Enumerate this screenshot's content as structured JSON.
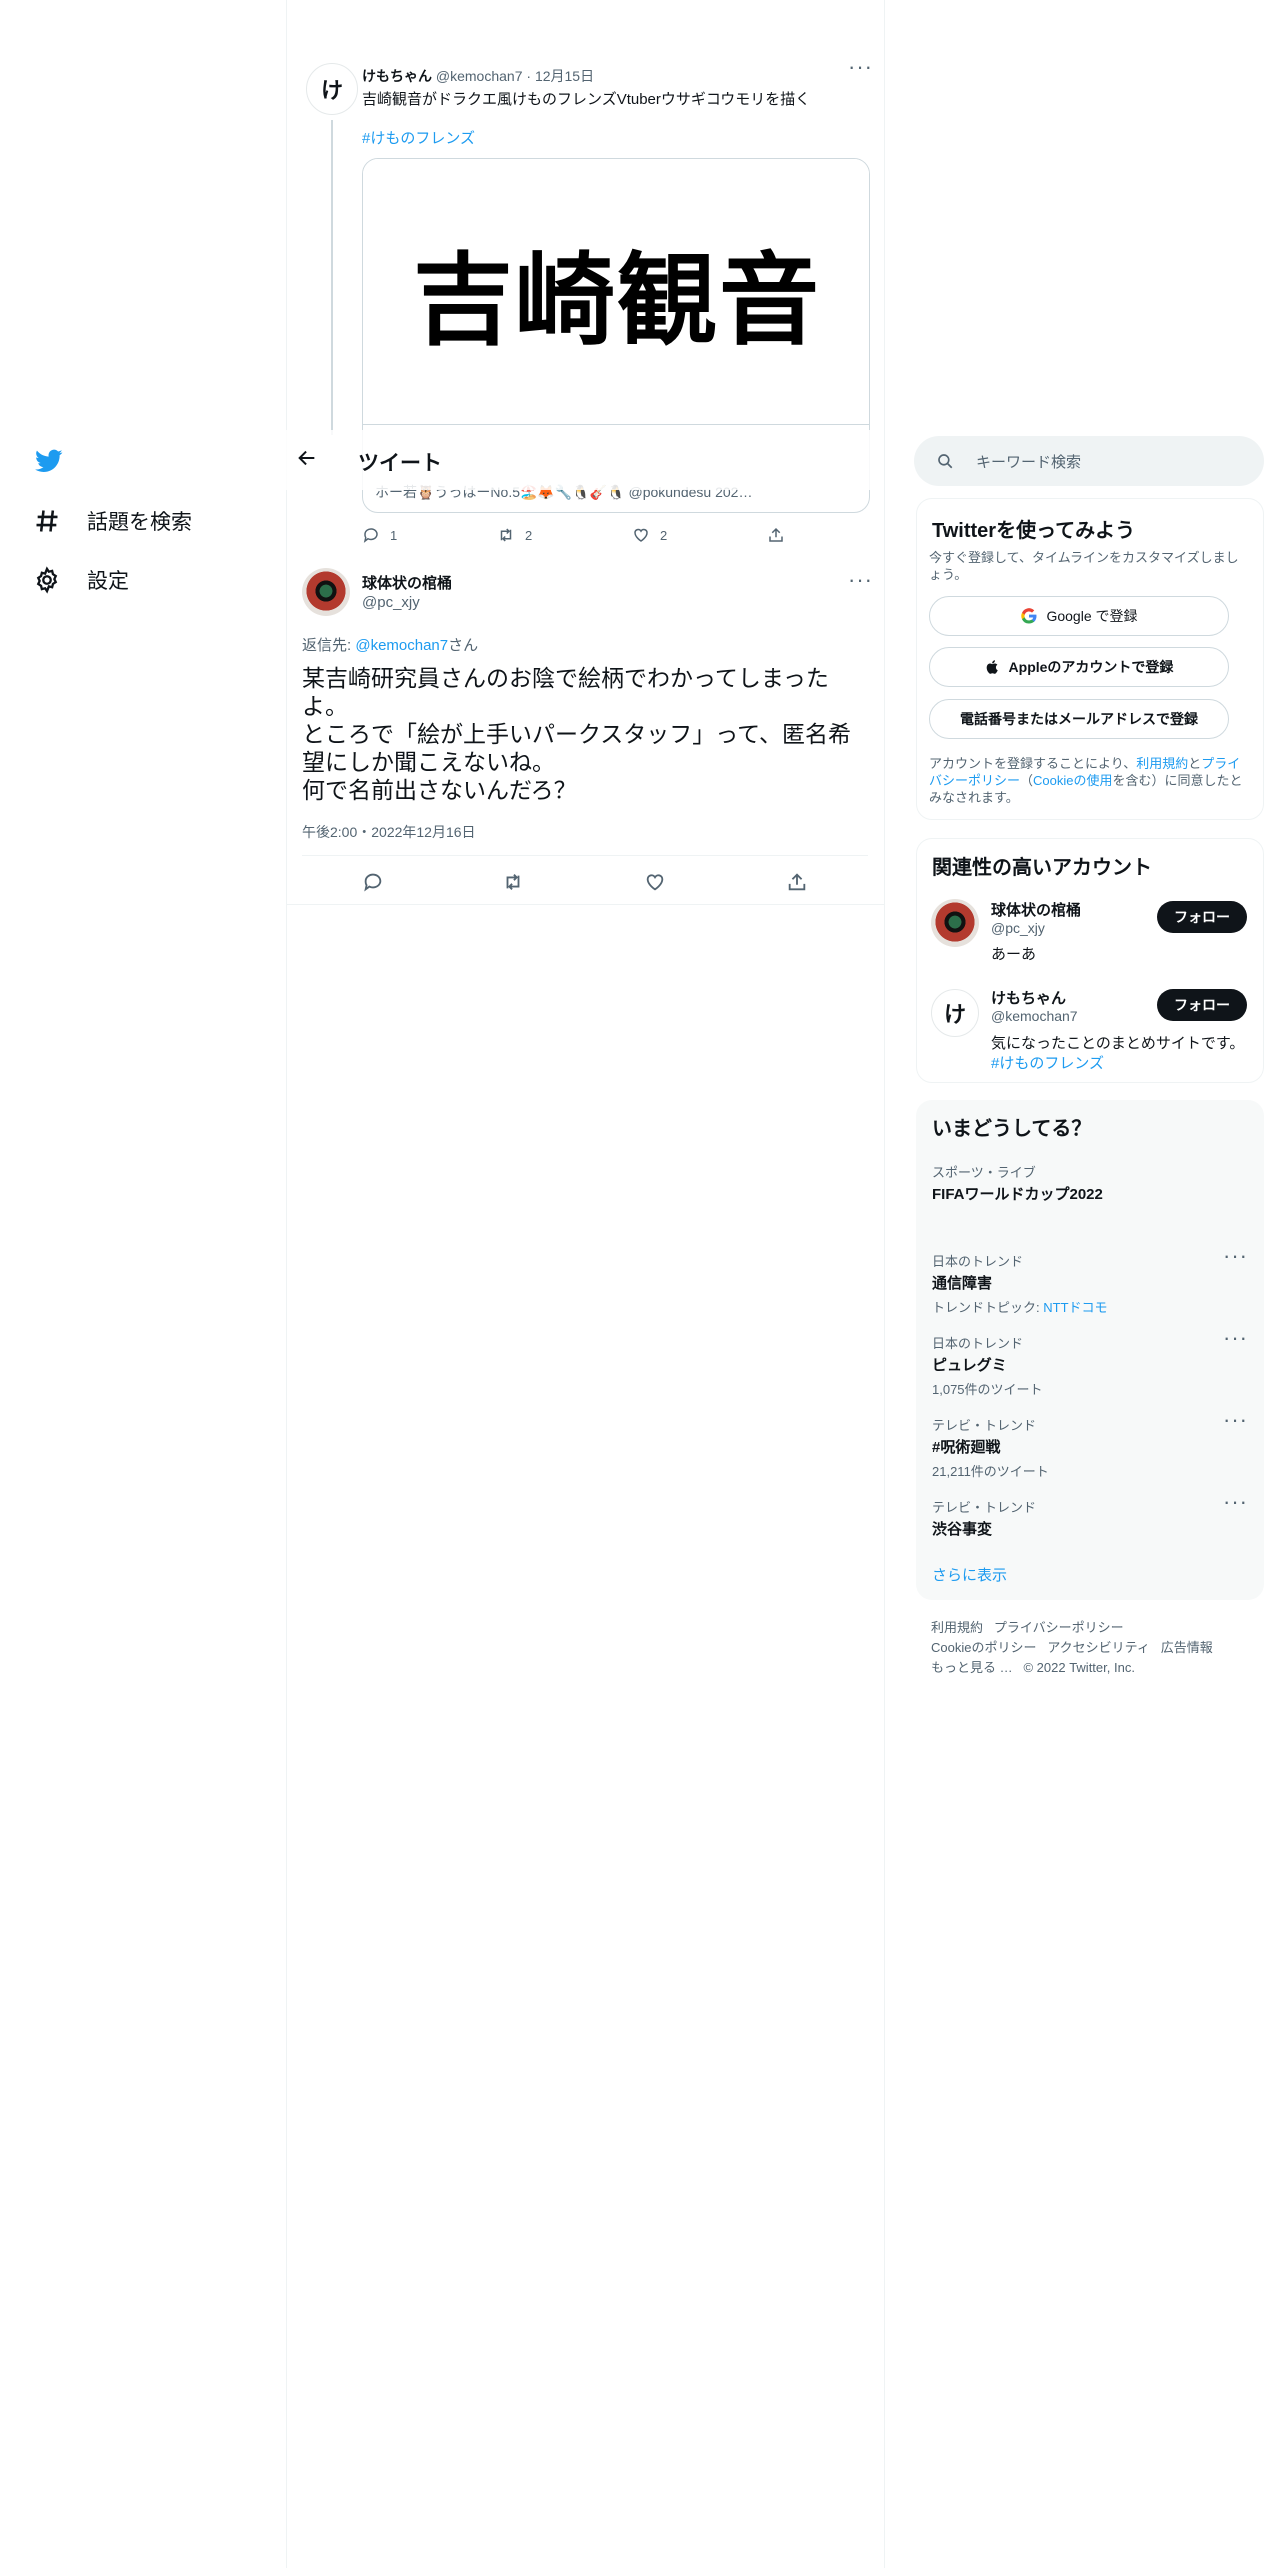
{
  "nav": {
    "logo": "twitter-bird-icon",
    "items": [
      {
        "label": "話題を検索",
        "icon": "hashtag-icon"
      },
      {
        "label": "設定",
        "icon": "gear-icon"
      }
    ]
  },
  "header": {
    "title": "ツイート"
  },
  "quoted_tweet": {
    "avatar_letter": "け",
    "name": "けもちゃん",
    "handle": "@kemochan7",
    "date": "12月15日",
    "text": "吉崎観音がドラクエ風けものフレンズVtuberウサギコウモリを描く",
    "hashtag": "#けものフレンズ",
    "card_image_text": "吉崎観音",
    "card_caption": "ホー若🦉うっはーNo.5🏖️🦊🔧🐧🎸🐧 @pokundesu 202…",
    "replies": "1",
    "retweets": "2",
    "likes": "2"
  },
  "main_tweet": {
    "name": "球体状の棺桶",
    "handle": "@pc_xjy",
    "reply_prefix": "返信先: ",
    "reply_to": "@kemochan7",
    "reply_suffix": "さん",
    "text_lines": [
      "某吉崎研究員さんのお陰で絵柄でわかってしまった",
      "よ。",
      "ところで「絵が上手いパークスタッフ」って、匿名希",
      "望にしか聞こえないね。",
      "何で名前出さないんだろ？"
    ],
    "timestamp": "午後2:00・2022年12月16日"
  },
  "search": {
    "placeholder": "キーワード検索"
  },
  "signup": {
    "title": "Twitterを使ってみよう",
    "desc": "今すぐ登録して、タイムラインをカスタマイズしましょう。",
    "google": "Google で登録",
    "apple": "Appleのアカウントで登録",
    "phone": "電話番号またはメールアドレスで登録",
    "terms_1": "アカウントを登録することにより、",
    "terms_link1": "利用規約",
    "terms_2": "と",
    "terms_link2": "プライバシーポリシー",
    "terms_3": "（",
    "terms_link3": "Cookieの使用",
    "terms_4": "を含む）に同意したとみなされます。"
  },
  "related": {
    "title": "関連性の高いアカウント",
    "follow_label": "フォロー",
    "accounts": [
      {
        "name": "球体状の棺桶",
        "handle": "@pc_xjy",
        "bio": "あーあ",
        "bio_link": ""
      },
      {
        "name": "けもちゃん",
        "handle": "@kemochan7",
        "bio": "気になったことのまとめサイトです。",
        "bio_link": "#けものフレンズ",
        "avatar_letter": "け"
      }
    ]
  },
  "trends": {
    "title": "いまどうしてる？",
    "items": [
      {
        "category": "スポーツ・ライブ",
        "name": "FIFAワールドカップ2022",
        "sub": "",
        "sub_link": ""
      },
      {
        "category": "日本のトレンド",
        "name": "通信障害",
        "sub": "トレンドトピック: ",
        "sub_link": "NTTドコモ"
      },
      {
        "category": "日本のトレンド",
        "name": "ピュレグミ",
        "sub": "1,075件のツイート",
        "sub_link": ""
      },
      {
        "category": "テレビ・トレンド",
        "name": "#呪術廻戦",
        "sub": "21,211件のツイート",
        "sub_link": ""
      },
      {
        "category": "テレビ・トレンド",
        "name": "渋谷事変",
        "sub": "",
        "sub_link": ""
      }
    ],
    "show_more": "さらに表示"
  },
  "footer": {
    "links_row1": [
      "利用規約",
      "プライバシーポリシー"
    ],
    "links_row2": [
      "Cookieのポリシー",
      "アクセシビリティ",
      "広告情報"
    ],
    "more": "もっと見る …",
    "copyright": "© 2022 Twitter, Inc."
  },
  "colors": {
    "accent": "#1d9bf0",
    "text": "#0f1419",
    "muted": "#536471",
    "border": "#eff3f4"
  }
}
